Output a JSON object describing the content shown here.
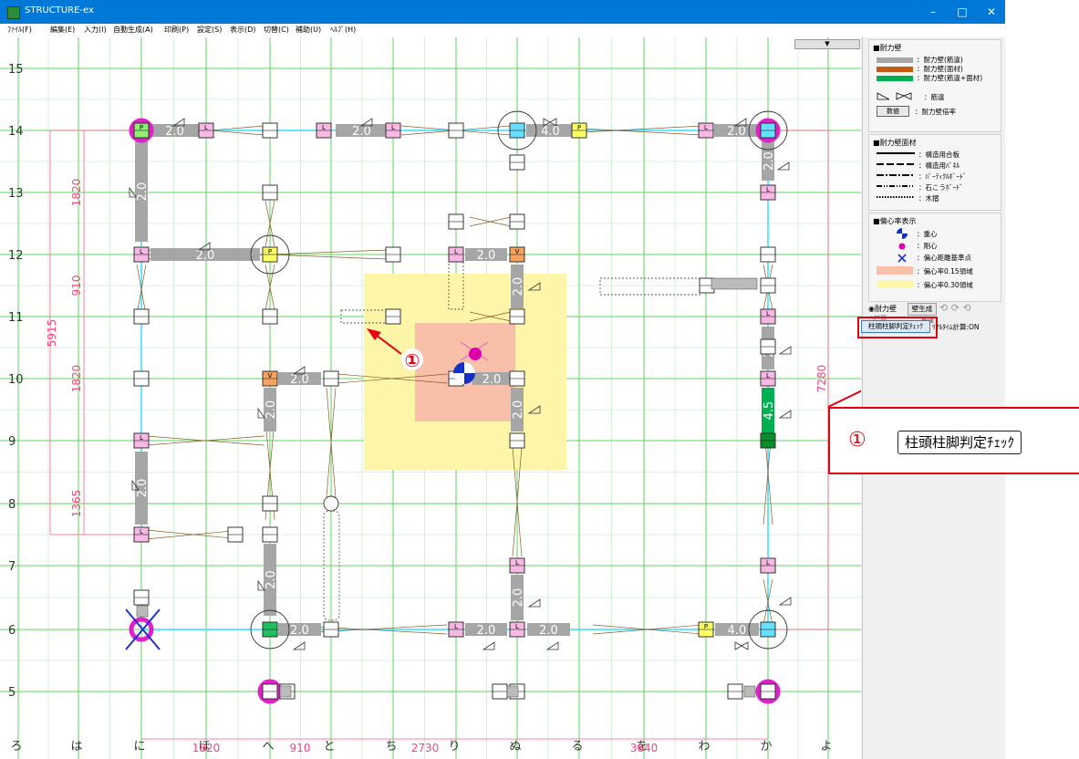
{
  "window": {
    "title": "STRUCTURE-ex",
    "controls": [
      "–",
      "□",
      "✕"
    ]
  },
  "menu": [
    "ﾌｧｲﾙ(F)",
    "編集(E)",
    "入力(I)",
    "自動生成(A)",
    "印刷(P)",
    "設定(S)",
    "表示(D)",
    "切替(C)",
    "補助(U)",
    "ﾍﾙﾌﾟ(H)"
  ],
  "grid": {
    "row_labels": [
      "15",
      "14",
      "13",
      "12",
      "11",
      "10",
      "9",
      "8",
      "7",
      "6",
      "5"
    ],
    "col_labels": [
      "ろ",
      "は",
      "に",
      "ほ",
      "へ",
      "と",
      "ち",
      "り",
      "ぬ",
      "る",
      "を",
      "わ",
      "か",
      "よ"
    ],
    "dimensions": {
      "left_total": "5915",
      "left_parts": [
        "1820",
        "910",
        "1820",
        "1365"
      ],
      "right_total": "7280",
      "bottom": [
        "1820",
        "910",
        "2730",
        "3640"
      ]
    }
  },
  "walls": {
    "values": [
      "2.0",
      "2.0",
      "4.0",
      "2.0",
      "2.0",
      "2.0",
      "2.0",
      "2.0",
      "2.0",
      "2.0",
      "2.0",
      "2.0",
      "2.0",
      "2.0",
      "2.0",
      "2.0",
      "2.0",
      "2.0",
      "4.0",
      "2.0",
      "2.0",
      "4.5"
    ],
    "tags": {
      "pp": "P",
      "vv": "V",
      "ll": "L"
    }
  },
  "annotation_marker": "①",
  "sidebar": {
    "dropdown_arrow": "▼",
    "legend_walls": {
      "header": "■耐力壁",
      "items": [
        {
          "color": "#a6a6a6",
          "label": "：耐力壁(筋違)"
        },
        {
          "color": "#c55a11",
          "label": "：耐力壁(面材)"
        },
        {
          "color": "#00b050",
          "label": "：耐力壁(筋違+面材)"
        }
      ],
      "brace_label": "：筋違",
      "mult_box": "数値",
      "mult_label": "：耐力壁倍率"
    },
    "legend_panels": {
      "header": "■耐力壁面材",
      "items": [
        "：構造用合板",
        "：構造用ﾊﾟﾈﾙ",
        "：ﾊﾟｰﾃｨｸﾙﾎﾞｰﾄﾞ",
        "：石こうﾎﾞｰﾄﾞ",
        "：木摺"
      ]
    },
    "legend_ecc": {
      "header": "■偏心率表示",
      "items": [
        "：重心",
        "：剛心",
        "：偏心距離基準点",
        "：偏心率0.15領域",
        "：偏心率0.30領域"
      ],
      "colors": {
        "r015": "#f8c0a8",
        "r030": "#fdf6a8"
      }
    },
    "controls": {
      "radio1": "耐力壁",
      "radio2": "柱頭",
      "gen_button": "壁生成",
      "stray": "筋違",
      "check_button": "柱頭柱脚判定ﾁｪｯｸ",
      "realtime": "ﾘｱﾙﾀｲﾑ計算:ON"
    }
  },
  "callout": {
    "number": "①",
    "button_label": "柱頭柱脚判定ﾁｪｯｸ"
  },
  "colors": {
    "accent_red": "#e60012",
    "titlebar": "#0078d7",
    "gridline_green": "#55d455",
    "dim_pink": "#ff4081",
    "wall_gray": "#a6a6a6",
    "wall_orange": "#c55a11",
    "wall_green": "#00b050",
    "tag_pink": "#f7b8e4",
    "tag_yellow": "#ffff66",
    "tag_orange": "#f4a460"
  }
}
